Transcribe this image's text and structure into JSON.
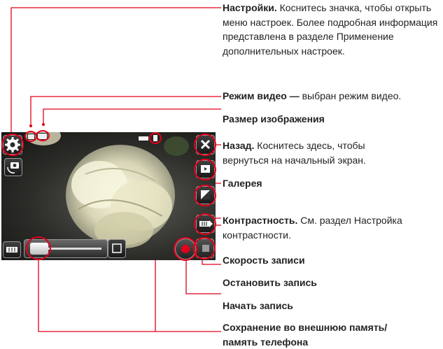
{
  "annotations": [
    {
      "title": "Настройки.",
      "text": " Коснитесь значка, чтобы открыть меню настроек. Более подробная информация представлена в разделе Применение дополнительных настроек."
    },
    {
      "title": "Режим видео —",
      "text": " выбран режим видео."
    },
    {
      "title": "Размер изображения",
      "text": ""
    },
    {
      "title": "Назад.",
      "text": " Коснитесь здесь, чтобы вернуться на начальный экран."
    },
    {
      "title": "Галерея",
      "text": ""
    },
    {
      "title": "Контрастность.",
      "text": " См. раздел Настройка контрастности."
    },
    {
      "title": "Скорость записи",
      "text": ""
    },
    {
      "title": "Остановить запись",
      "text": ""
    },
    {
      "title": "Начать запись",
      "text": ""
    },
    {
      "title": "Сохранение во внешнюю память/ память телефона",
      "text": ""
    }
  ],
  "colors": {
    "callout": "#e2001a",
    "record": "#e2001a"
  },
  "icons": [
    "gear-icon",
    "camera-switch-icon",
    "video-mode-icon",
    "image-size-icon",
    "memory-icon",
    "phone-memory-icon",
    "close-icon",
    "gallery-icon",
    "contrast-icon",
    "speed-icon",
    "record-icon",
    "stop-icon",
    "zoom-slider",
    "zoom-icon"
  ]
}
